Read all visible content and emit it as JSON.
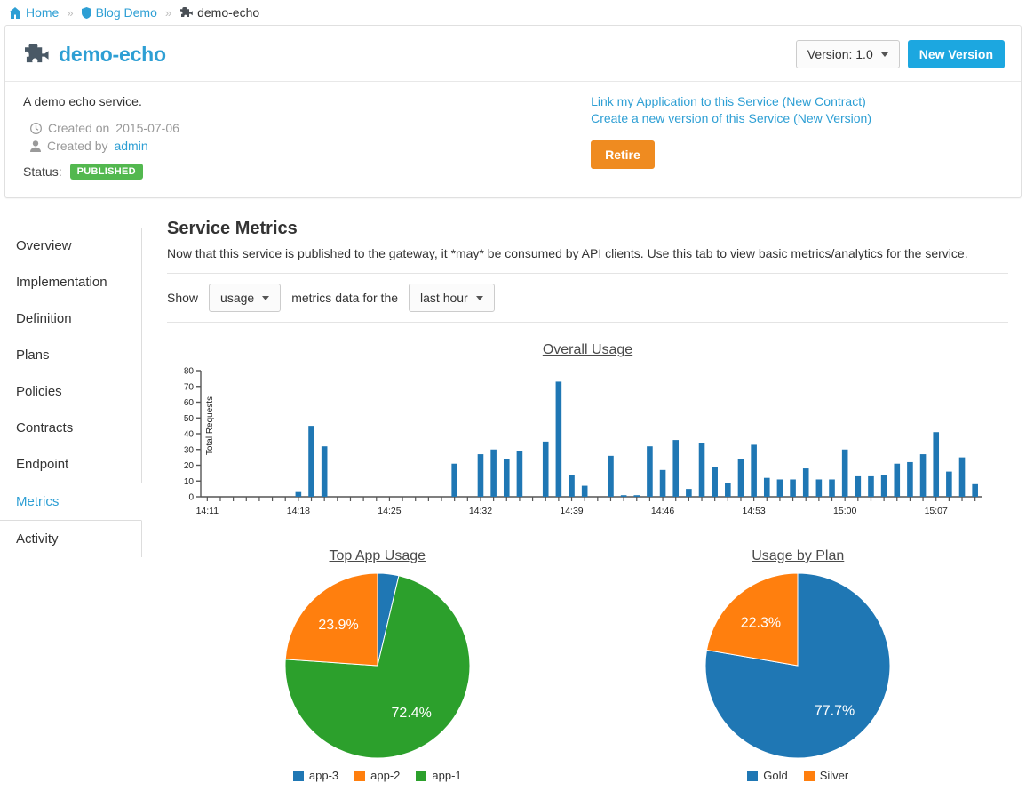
{
  "breadcrumb": [
    {
      "label": "Home",
      "icon": "home-icon",
      "link": true
    },
    {
      "label": "Blog Demo",
      "icon": "shield-icon",
      "link": true
    },
    {
      "label": "demo-echo",
      "icon": "puzzle-icon",
      "link": false
    }
  ],
  "breadcrumb_separator": "»",
  "header": {
    "title": "demo-echo",
    "icon": "puzzle-icon",
    "version_label": "Version: 1.0",
    "new_version_label": "New Version"
  },
  "service": {
    "description": "A demo echo service.",
    "created_on_label": "Created on",
    "created_on_value": "2015-07-06",
    "created_by_label": "Created by",
    "created_by_value": "admin",
    "status_label": "Status:",
    "status_value": "PUBLISHED",
    "links": [
      "Link my Application to this Service (New Contract)",
      "Create a new version of this Service (New Version)"
    ],
    "retire_label": "Retire"
  },
  "sidebar": {
    "items": [
      {
        "label": "Overview",
        "active": false
      },
      {
        "label": "Implementation",
        "active": false
      },
      {
        "label": "Definition",
        "active": false
      },
      {
        "label": "Plans",
        "active": false
      },
      {
        "label": "Policies",
        "active": false
      },
      {
        "label": "Contracts",
        "active": false
      },
      {
        "label": "Endpoint",
        "active": false
      },
      {
        "label": "Metrics",
        "active": true
      },
      {
        "label": "Activity",
        "active": false
      }
    ]
  },
  "main": {
    "section_title": "Service Metrics",
    "section_desc": "Now that this service is published to the gateway, it *may* be consumed by API clients. Use this tab to view basic metrics/analytics for the service.",
    "filter": {
      "prefix": "Show",
      "metric_value": "usage",
      "middle": "metrics data for the",
      "period_value": "last hour"
    }
  },
  "colors": {
    "accent_blue": "#1ca7e0",
    "link_blue": "#2e9fd4",
    "orange": "#ef8b20",
    "green_badge": "#53b84f",
    "chart_blue": "#1f77b4",
    "chart_orange": "#ff7f0e",
    "chart_green": "#2ca02c"
  },
  "chart_data": [
    {
      "type": "bar",
      "title": "Overall Usage",
      "xlabel": "",
      "ylabel": "Total Requests",
      "ylim": [
        0,
        80
      ],
      "yticks": [
        0,
        10,
        20,
        30,
        40,
        50,
        60,
        70,
        80
      ],
      "xtick_labels": [
        "14:11",
        "14:18",
        "14:25",
        "14:32",
        "14:39",
        "14:46",
        "14:53",
        "15:00",
        "15:07"
      ],
      "xtick_indices": [
        0,
        7,
        14,
        21,
        28,
        35,
        42,
        49,
        56
      ],
      "grid": false,
      "bar_color": "#1f77b4",
      "x": [
        "14:11",
        "14:12",
        "14:13",
        "14:14",
        "14:15",
        "14:16",
        "14:17",
        "14:18",
        "14:19",
        "14:20",
        "14:21",
        "14:22",
        "14:23",
        "14:24",
        "14:25",
        "14:26",
        "14:27",
        "14:28",
        "14:29",
        "14:30",
        "14:31",
        "14:32",
        "14:33",
        "14:34",
        "14:35",
        "14:36",
        "14:37",
        "14:38",
        "14:39",
        "14:40",
        "14:41",
        "14:42",
        "14:43",
        "14:44",
        "14:45",
        "14:46",
        "14:47",
        "14:48",
        "14:49",
        "14:50",
        "14:51",
        "14:52",
        "14:53",
        "14:54",
        "14:55",
        "14:56",
        "14:57",
        "14:58",
        "14:59",
        "15:00",
        "15:01",
        "15:02",
        "15:03",
        "15:04",
        "15:05",
        "15:06",
        "15:07",
        "15:08",
        "15:09",
        "15:10"
      ],
      "values": [
        0,
        0,
        0,
        0,
        0,
        0,
        0,
        3,
        45,
        32,
        0,
        0,
        0,
        0,
        0,
        0,
        0,
        0,
        0,
        21,
        0,
        27,
        30,
        24,
        29,
        0,
        35,
        73,
        14,
        7,
        0,
        26,
        1,
        1,
        32,
        17,
        36,
        5,
        34,
        19,
        9,
        24,
        33,
        12,
        11,
        11,
        18,
        11,
        11,
        30,
        13,
        13,
        14,
        21,
        22,
        27,
        41,
        16,
        25,
        8
      ]
    },
    {
      "type": "pie",
      "title": "Top App Usage",
      "labels": [
        "app-3",
        "app-2",
        "app-1"
      ],
      "values": [
        3.7,
        23.9,
        72.4
      ],
      "display_labels": [
        "",
        "23.9%",
        "72.4%"
      ],
      "colors": [
        "#1f77b4",
        "#ff7f0e",
        "#2ca02c"
      ],
      "legend_position": "bottom",
      "slice_order": [
        "app-3",
        "app-1",
        "app-2"
      ]
    },
    {
      "type": "pie",
      "title": "Usage by Plan",
      "labels": [
        "Gold",
        "Silver"
      ],
      "values": [
        77.7,
        22.3
      ],
      "display_labels": [
        "77.7%",
        "22.3%"
      ],
      "colors": [
        "#1f77b4",
        "#ff7f0e"
      ],
      "legend_position": "bottom",
      "slice_order": [
        "Gold",
        "Silver"
      ]
    }
  ]
}
